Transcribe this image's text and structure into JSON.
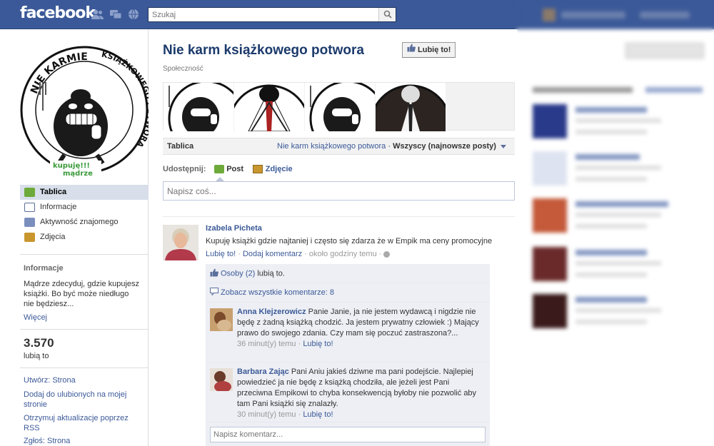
{
  "topbar": {
    "logo": "facebook",
    "search_placeholder": "Szukaj",
    "icons": [
      "friend-requests-icon",
      "messages-icon",
      "notifications-icon",
      "search-icon"
    ]
  },
  "page": {
    "title": "Nie karm książkowego potwora",
    "category": "Społeczność",
    "like_button": "Lubię to!",
    "cover_logo_text": [
      "NIE KARMIE KSIĄŻKOWEGO POTWORA",
      "kupuję!!!",
      "mądrze"
    ]
  },
  "sidebar": {
    "nav": [
      {
        "label": "Tablica",
        "icon": "wall-icon",
        "active": true
      },
      {
        "label": "Informacje",
        "icon": "info-icon",
        "active": false
      },
      {
        "label": "Aktywność znajomego",
        "icon": "friends-activity-icon",
        "active": false
      },
      {
        "label": "Zdjęcia",
        "icon": "photos-icon",
        "active": false
      }
    ],
    "info_heading": "Informacje",
    "info_text": "Mądrze zdecyduj, gdzie kupujesz książki. Bo być może niedługo nie będziesz...",
    "more_link": "Więcej",
    "likes_count": "3.570",
    "likes_label": "lubią to",
    "links": [
      "Utwórz: Strona",
      "Dodaj do ulubionych na mojej stronie",
      "Otrzymuj aktualizacje poprzez RSS",
      "Zgłoś: Strona"
    ]
  },
  "wall": {
    "tab_label": "Tablica",
    "filter_page": "Nie karm książkowego potwora",
    "filter_sep": " · ",
    "filter_all": "Wszyscy (najnowsze posty)",
    "share_label": "Udostępnij:",
    "share_post": "Post",
    "share_photo": "Zdjęcie",
    "composer_placeholder": "Napisz coś..."
  },
  "post": {
    "author": "Izabela Picheta",
    "text": "Kupuję książki gdzie najtaniej i często się zdarza że w Empik ma ceny promocyjne",
    "like": "Lubię to!",
    "add_comment": "Dodaj komentarz",
    "time": "około godziny temu",
    "sep": " · ",
    "likes_people": "Osoby (2)",
    "likes_suffix": " lubią to.",
    "view_all": "Zobacz wszystkie komentarze: 8",
    "comments": [
      {
        "author": "Anna Klejzerowicz",
        "text": "Panie Janie, ja nie jestem wydawcą i nigdzie nie będę z żadną książką chodzić. Ja jestem prywatny człowiek :) Mający prawo do swojego zdania. Czy mam się poczuć zastraszona?...",
        "time": "36 minut(y) temu",
        "like": "Lubię to!"
      },
      {
        "author": "Barbara Zając",
        "text": "Pani Aniu jakieś dziwne ma pani podejście. Najlepiej powiedzieć ja nie będę z książką chodziła, ale jeżeli jest Pani przeciwna Empikowi to chyba konsekwencją byłoby nie pozwolić aby tam Pani książki się znalazły.",
        "time": "30 minut(y) temu",
        "like": "Lubię to!"
      }
    ],
    "comment_placeholder": "Napisz komentarz..."
  },
  "colors": {
    "brand": "#3b5998",
    "nav_active": "#d8dfea",
    "ufi_bg": "#edeff4"
  }
}
